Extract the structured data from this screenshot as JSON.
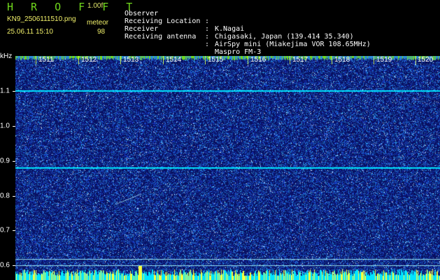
{
  "header": {
    "brand": "H R O F F T",
    "version": "1.00f",
    "file_name": "KN9_2506111510.png",
    "meteor_label": "meteor",
    "date_time": "25.06.11 15:10",
    "meteor_count": "98"
  },
  "metadata": [
    {
      "label": "Observer",
      "separator": ":",
      "value": "K.Nagai"
    },
    {
      "label": "Receiving Location",
      "separator": ":",
      "value": "Chigasaki, Japan (139.414 35.340)"
    },
    {
      "label": "Receiver",
      "separator": ":",
      "value": "AirSpy mini (Miakejima VOR 108.65MHz)"
    },
    {
      "label": "Receiving antenna",
      "separator": ":",
      "value": "Maspro FM-3"
    }
  ],
  "axis": {
    "unit": "kHz",
    "labels": [
      "1.1",
      "1.0",
      "0.9",
      "0.8",
      "0.7",
      "0.6"
    ]
  },
  "timeline": {
    "labels": [
      "1511",
      "1512",
      "1513",
      "1514",
      "1515",
      "1516",
      "1517",
      "1518",
      "1519",
      "1520"
    ]
  },
  "colors": {
    "background": "#000000",
    "plot": "#02064b",
    "noise": "#4169ff",
    "cyan": "#00e5ff",
    "yellow": "#f8ff3c",
    "green": "#70d81c",
    "white": "#ffffff"
  }
}
